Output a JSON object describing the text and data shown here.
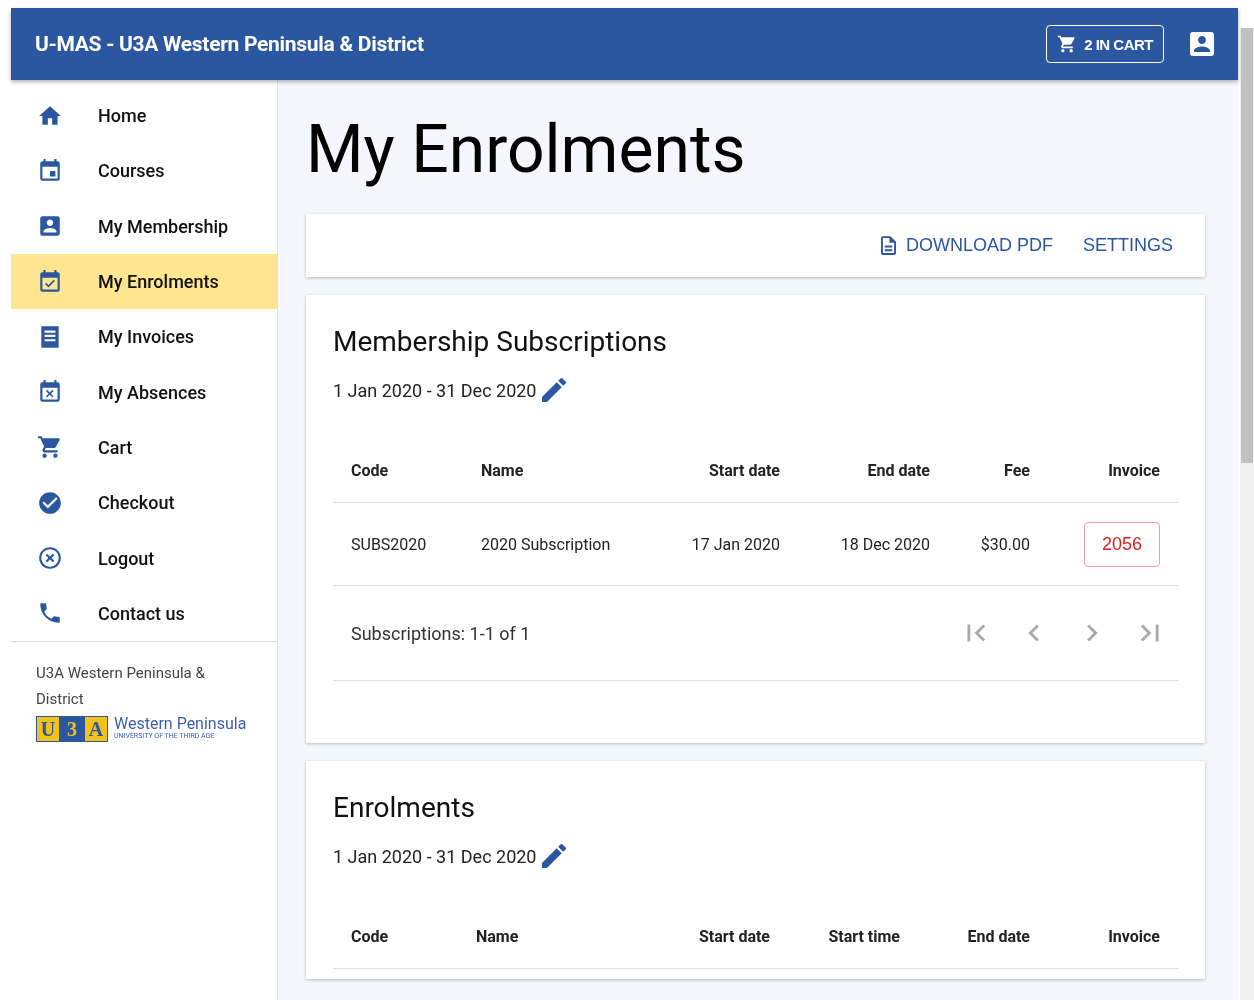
{
  "app_bar": {
    "title": "U-MAS - U3A Western Peninsula & District",
    "cart_button": "2 IN CART"
  },
  "sidebar": {
    "items": [
      {
        "label": "Home",
        "selected": false
      },
      {
        "label": "Courses",
        "selected": false
      },
      {
        "label": "My Membership",
        "selected": false
      },
      {
        "label": "My Enrolments",
        "selected": true
      },
      {
        "label": "My Invoices",
        "selected": false
      },
      {
        "label": "My Absences",
        "selected": false
      },
      {
        "label": "Cart",
        "selected": false
      },
      {
        "label": "Checkout",
        "selected": false
      },
      {
        "label": "Logout",
        "selected": false
      },
      {
        "label": "Contact us",
        "selected": false
      }
    ],
    "footer_text": "U3A Western Peninsula & District",
    "logo": {
      "letters": [
        "U",
        "3",
        "A"
      ],
      "name": "Western Peninsula",
      "tagline": "UNIVERSITY OF THE THIRD AGE"
    }
  },
  "page_title": "My Enrolments",
  "toolbar": {
    "download_button": "DOWNLOAD PDF",
    "settings_button": "SETTINGS"
  },
  "membership": {
    "title": "Membership Subscriptions",
    "period": "1 Jan 2020 - 31 Dec 2020",
    "columns": [
      "Code",
      "Name",
      "Start date",
      "End date",
      "Fee",
      "Invoice"
    ],
    "rows": [
      {
        "cells": [
          "SUBS2020",
          "2020 Subscription",
          "17 Jan 2020",
          "18 Dec 2020",
          "$30.00"
        ],
        "invoice": "2056"
      }
    ],
    "pagination": "Subscriptions: 1-1 of 1"
  },
  "enrolments": {
    "title": "Enrolments",
    "period": "1 Jan 2020 - 31 Dec 2020",
    "columns": [
      "Code",
      "Name",
      "Start date",
      "Start time",
      "End date",
      "Invoice"
    ]
  }
}
